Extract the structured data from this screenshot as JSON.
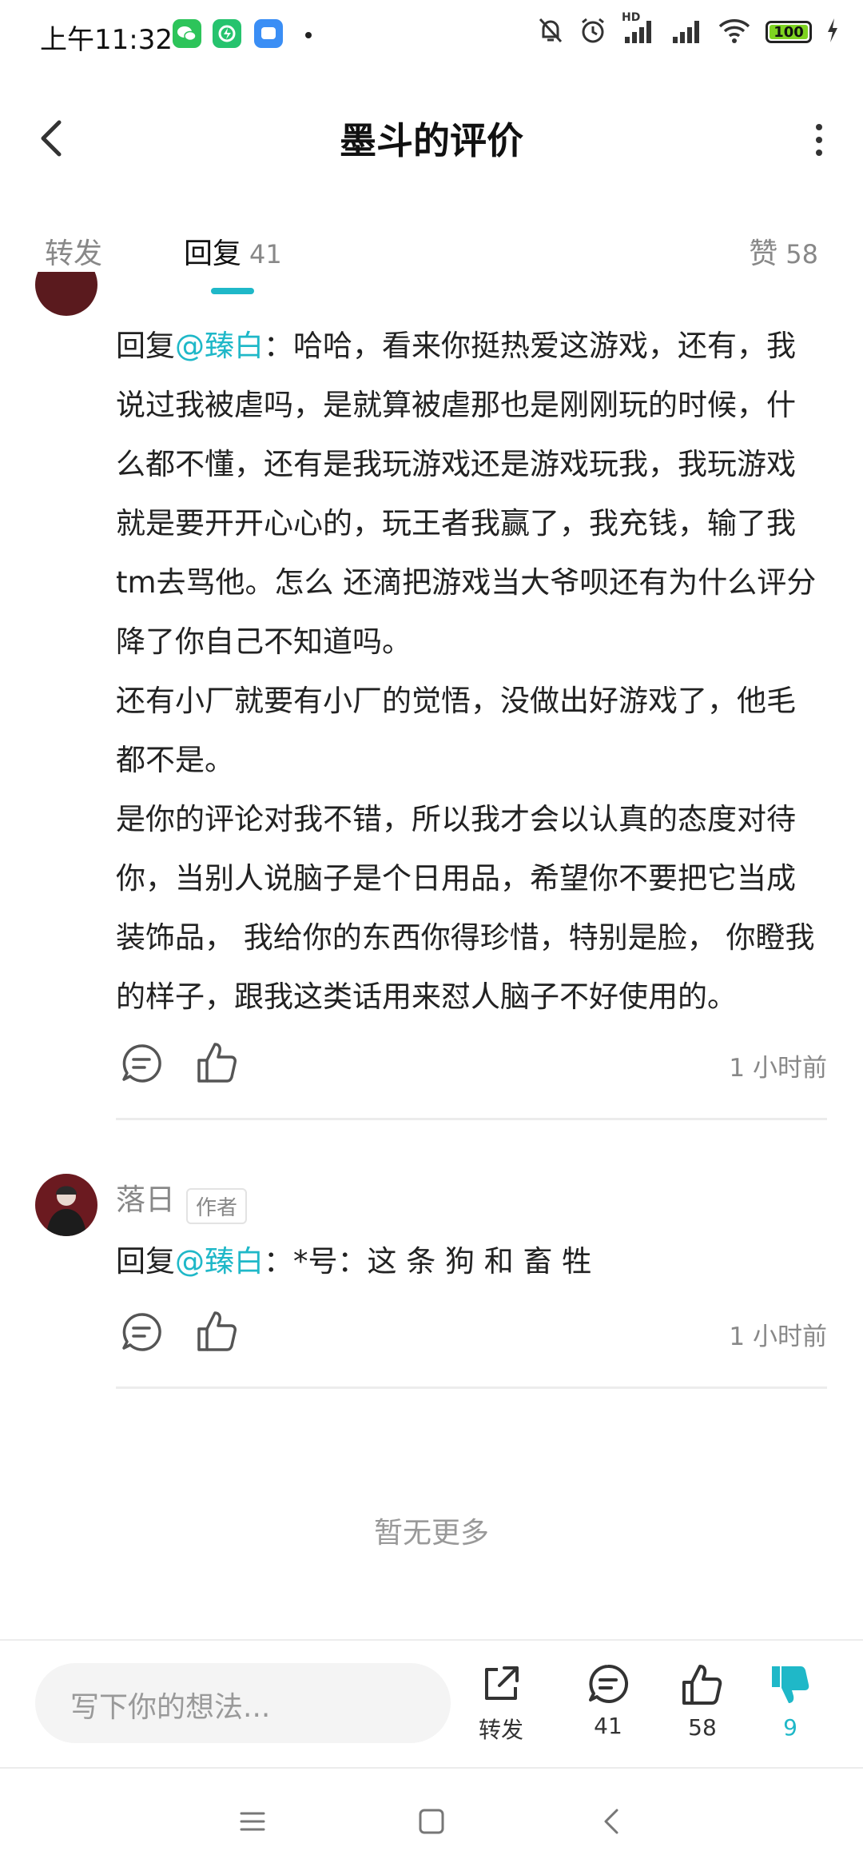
{
  "status_bar": {
    "time": "上午11:32",
    "battery": "100",
    "wifi_icon": "wifi-icon",
    "signal_label": "HD"
  },
  "header": {
    "title": "墨斗的评价"
  },
  "tabs": [
    {
      "label": "转发"
    },
    {
      "label": "回复",
      "count": "41"
    },
    {
      "label": "赞",
      "count": "58"
    }
  ],
  "comments": [
    {
      "prefix": "回复",
      "mention": "@臻白",
      "sep": "：",
      "paragraphs": [
        "哈哈，看来你挺热爱这游戏，还有，我说过我被虐吗，是就算被虐那也是刚刚玩的时候，什么都不懂，还有是我玩游戏还是游戏玩我，我玩游戏就是要开开心心的，玩王者我赢了，我充钱，输了我tm去骂他。怎么 还滴把游戏当大爷呗还有为什么评分降了你自己不知道吗。",
        "还有小厂就要有小厂的觉悟，没做出好游戏了，他毛都不是。",
        "是你的评论对我不错，所以我才会以认真的态度对待你，当别人说脑子是个日用品，希望你不要把它当成装饰品， 我给你的东西你得珍惜，特别是脸， 你瞪我的样子，跟我这类话用来怼人脑子不好使用的。"
      ],
      "time": "1 小时前"
    },
    {
      "author": "落日",
      "badge": "作者",
      "prefix": "回复",
      "mention": "@臻白",
      "sep": "：",
      "body": "*号：这 条 狗 和 畜 牲",
      "time": "1 小时前"
    }
  ],
  "footer_note": "暂无更多",
  "bottom_bar": {
    "input_placeholder": "写下你的想法...",
    "share_label": "转发",
    "comment_count": "41",
    "like_count": "58",
    "dislike_count": "9"
  },
  "colors": {
    "accent": "#1fb8c8",
    "text": "#222222",
    "muted": "#888888"
  }
}
